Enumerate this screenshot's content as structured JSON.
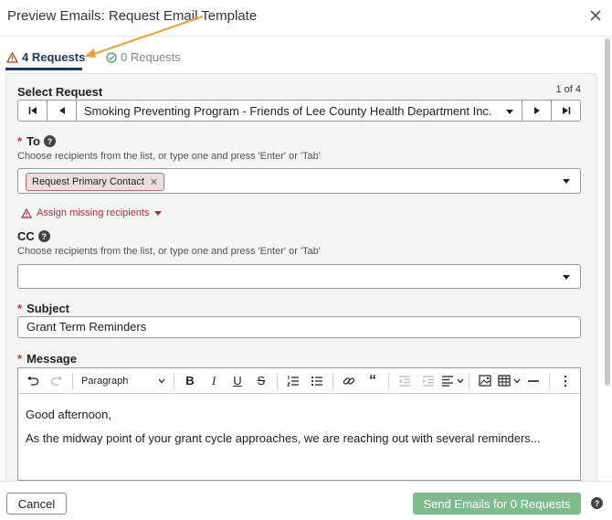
{
  "dialog": {
    "title": "Preview Emails: Request Email Template"
  },
  "tabs": [
    {
      "label": "4 Requests",
      "icon": "warning-icon",
      "active": true
    },
    {
      "label": "0 Requests",
      "icon": "check-circle-icon",
      "active": false
    }
  ],
  "select_request": {
    "label": "Select Request",
    "counter": "1 of 4",
    "value": "Smoking Preventing Program - Friends of Lee County Health Department Inc."
  },
  "to": {
    "required_mark": "*",
    "label": "To",
    "hint": "Choose recipients from the list, or type one and press 'Enter' or 'Tab'",
    "chips": [
      "Request Primary Contact"
    ],
    "assign_link": "Assign missing recipients"
  },
  "cc": {
    "label": "CC",
    "hint": "Choose recipients from the list, or type one and press 'Enter' or 'Tab'"
  },
  "subject": {
    "required_mark": "*",
    "label": "Subject",
    "value": "Grant Term Reminders"
  },
  "message": {
    "required_mark": "*",
    "label": "Message",
    "toolbar": {
      "paragraph_label": "Paragraph"
    },
    "body": [
      "Good afternoon,",
      "As the midway point of your grant cycle approaches, we are reaching out with several reminders..."
    ]
  },
  "footer": {
    "cancel_label": "Cancel",
    "send_label": "Send Emails for 0 Requests"
  },
  "colors": {
    "accent": "#1f3a5c",
    "required": "#c0392b",
    "send": "#7dbb8c",
    "annotation": "#e8a23a"
  }
}
